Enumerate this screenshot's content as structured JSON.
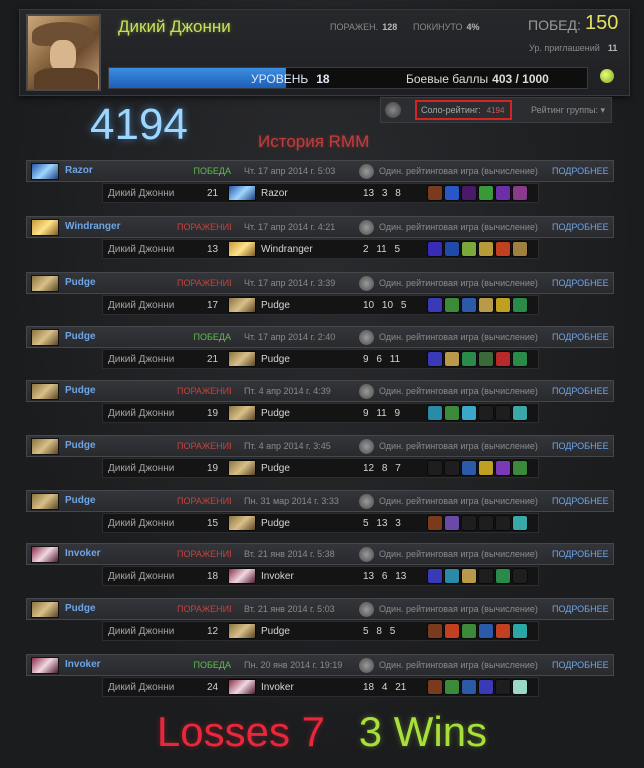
{
  "profile": {
    "name": "Дикий Джонни",
    "losses_label": "ПОРАЖЕН.",
    "losses_value": "128",
    "abandoned_label": "ПОКИНУТО",
    "abandoned_value": "4%",
    "wins_label": "ПОБЕД:",
    "wins_value": "150",
    "invite_label": "Ур. приглашений",
    "invite_value": "11",
    "level_label": "УРОВЕНЬ",
    "level_value": "18",
    "level_progress": 0.37,
    "battle_label": "Боевые баллы",
    "battle_value": "403 / 1000"
  },
  "rating": {
    "big_value": "4194",
    "history_title": "История RMM",
    "solo_label": "Соло-рейтинг:",
    "solo_value": "4194",
    "group_label": "Рейтинг группы:"
  },
  "matches": [
    {
      "hero": "Razor",
      "hero_icon": "razor",
      "result": "ПОБЕДА",
      "result_type": "win",
      "date": "Чт. 17 апр 2014 г. 5:03",
      "mode": "Один. рейтинговая игра (вычисление)",
      "details": "ПОДРОБНЕЕ",
      "player": "Дикий Джонни",
      "level": "21",
      "k": "13",
      "d": "3",
      "a": "8",
      "items": [
        "#7a3a1e",
        "#2858c8",
        "#4a1a6a",
        "#3a9a3a",
        "#6c2fa8",
        "#8a3a8a"
      ]
    },
    {
      "hero": "Windranger",
      "hero_icon": "wind",
      "result": "ПОРАЖЕНИЕ",
      "result_type": "loss",
      "date": "Чт. 17 апр 2014 г. 4:21",
      "mode": "Один. рейтинговая игра (вычисление)",
      "details": "ПОДРОБНЕЕ",
      "player": "Дикий Джонни",
      "level": "13",
      "k": "2",
      "d": "11",
      "a": "5",
      "items": [
        "#3a2ab8",
        "#1f4aa8",
        "#7aa83a",
        "#b89a3a",
        "#c04020",
        "#a08040"
      ]
    },
    {
      "hero": "Pudge",
      "hero_icon": "pudge",
      "result": "ПОРАЖЕНИЕ",
      "result_type": "loss",
      "date": "Чт. 17 апр 2014 г. 3:39",
      "mode": "Один. рейтинговая игра (вычисление)",
      "details": "ПОДРОБНЕЕ",
      "player": "Дикий Джонни",
      "level": "17",
      "k": "10",
      "d": "10",
      "a": "5",
      "items": [
        "#3a3ab8",
        "#3a8a3a",
        "#2a5aa8",
        "#b89a4a",
        "#c0a020",
        "#2a8a4a"
      ]
    },
    {
      "hero": "Pudge",
      "hero_icon": "pudge",
      "result": "ПОБЕДА",
      "result_type": "win",
      "date": "Чт. 17 апр 2014 г. 2:40",
      "mode": "Один. рейтинговая игра (вычисление)",
      "details": "ПОДРОБНЕЕ",
      "player": "Дикий Джонни",
      "level": "21",
      "k": "9",
      "d": "6",
      "a": "11",
      "items": [
        "#3a3ab8",
        "#b89a4a",
        "#2a8a4a",
        "#3a6a3a",
        "#b82a2a",
        "#2a8a4a"
      ]
    },
    {
      "hero": "Pudge",
      "hero_icon": "pudge",
      "result": "ПОРАЖЕНИЕ",
      "result_type": "loss",
      "date": "Пт. 4 апр 2014 г. 4:39",
      "mode": "Один. рейтинговая игра (вычисление)",
      "details": "ПОДРОБНЕЕ",
      "player": "Дикий Джонни",
      "level": "19",
      "k": "9",
      "d": "11",
      "a": "9",
      "items": [
        "#2a8aa8",
        "#3a8a3a",
        "#3aa8c8",
        "#1e1e1e",
        "#1e1e1e",
        "#3aa8a8"
      ]
    },
    {
      "hero": "Pudge",
      "hero_icon": "pudge",
      "result": "ПОРАЖЕНИЕ",
      "result_type": "loss",
      "date": "Пт. 4 апр 2014 г. 3:45",
      "mode": "Один. рейтинговая игра (вычисление)",
      "details": "ПОДРОБНЕЕ",
      "player": "Дикий Джонни",
      "level": "19",
      "k": "12",
      "d": "8",
      "a": "7",
      "items": [
        "#1e1e1e",
        "#1e1e1e",
        "#2a5aa8",
        "#c0a020",
        "#7a3ab8",
        "#3a8a3a"
      ]
    },
    {
      "hero": "Pudge",
      "hero_icon": "pudge",
      "result": "ПОРАЖЕНИЕ",
      "result_type": "loss",
      "date": "Пн. 31 мар 2014 г. 3:33",
      "mode": "Один. рейтинговая игра (вычисление)",
      "details": "ПОДРОБНЕЕ",
      "player": "Дикий Джонни",
      "level": "15",
      "k": "5",
      "d": "13",
      "a": "3",
      "items": [
        "#7a3a1e",
        "#6a4aa8",
        "#1e1e1e",
        "#1e1e1e",
        "#1e1e1e",
        "#3aa8a8"
      ]
    },
    {
      "hero": "Invoker",
      "hero_icon": "inv",
      "result": "ПОРАЖЕНИЕ",
      "result_type": "loss",
      "date": "Вт. 21 янв 2014 г. 5:38",
      "mode": "Один. рейтинговая игра (вычисление)",
      "details": "ПОДРОБНЕЕ",
      "player": "Дикий Джонни",
      "level": "18",
      "k": "13",
      "d": "6",
      "a": "13",
      "items": [
        "#3a3ab8",
        "#2a8aa8",
        "#b89a4a",
        "#1e1e1e",
        "#2a8a4a",
        "#1e1e1e"
      ]
    },
    {
      "hero": "Pudge",
      "hero_icon": "pudge",
      "result": "ПОРАЖЕНИЕ",
      "result_type": "loss",
      "date": "Вт. 21 янв 2014 г. 5:03",
      "mode": "Один. рейтинговая игра (вычисление)",
      "details": "ПОДРОБНЕЕ",
      "player": "Дикий Джонни",
      "level": "12",
      "k": "5",
      "d": "8",
      "a": "5",
      "items": [
        "#7a3a1e",
        "#c04020",
        "#3a8a3a",
        "#2a5aa8",
        "#c04020",
        "#2aa8a8"
      ]
    },
    {
      "hero": "Invoker",
      "hero_icon": "inv",
      "result": "ПОБЕДА",
      "result_type": "win",
      "date": "Пн. 20 янв 2014 г. 19:19",
      "mode": "Один. рейтинговая игра (вычисление)",
      "details": "ПОДРОБНЕЕ",
      "player": "Дикий Джонни",
      "level": "24",
      "k": "18",
      "d": "4",
      "a": "21",
      "items": [
        "#7a3a1e",
        "#3a8a3a",
        "#2a5aa8",
        "#3a3ab8",
        "#1e1e1e",
        "#9ad8c8"
      ]
    }
  ],
  "footer": {
    "losses_text": "Losses 7",
    "wins_text": "3 Wins"
  }
}
